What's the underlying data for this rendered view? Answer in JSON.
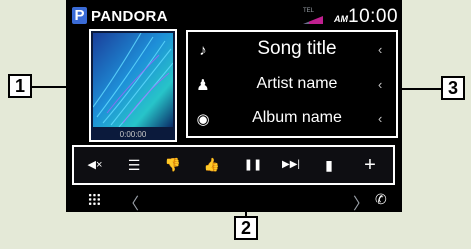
{
  "status_bar": {
    "app_logo": "P",
    "app_name": "PANDORA",
    "tel_label": "TEL",
    "ampm": "AM",
    "time": "10:00"
  },
  "album_art": {
    "elapsed_time": "0:00:00"
  },
  "track_info": {
    "song_title": "Song title",
    "artist_name": "Artist name",
    "album_name": "Album name"
  },
  "controls": [
    {
      "name": "mute",
      "glyph": "◀×"
    },
    {
      "name": "list",
      "glyph": "☰"
    },
    {
      "name": "thumbs-down",
      "glyph": "👎"
    },
    {
      "name": "thumbs-up",
      "glyph": "👍"
    },
    {
      "name": "pause",
      "glyph": "❚❚"
    },
    {
      "name": "skip",
      "glyph": "▶▶|"
    },
    {
      "name": "bookmark",
      "glyph": "▮"
    },
    {
      "name": "add",
      "glyph": "+"
    }
  ],
  "bottom_bar": {
    "nav_left": "〈",
    "nav_right": "〉",
    "phone": "✆"
  },
  "callouts": {
    "one": "1",
    "two": "2",
    "three": "3"
  },
  "colors": {
    "background": "#e4e9d7",
    "screen": "#000000",
    "logo_blue": "#3a6bd6",
    "frame": "#ffffff"
  }
}
